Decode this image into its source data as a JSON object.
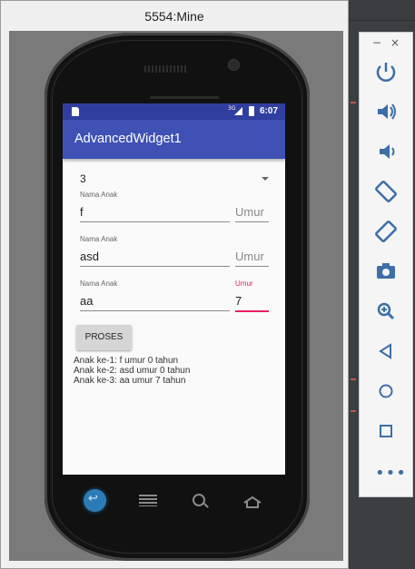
{
  "emulator": {
    "title": "5554:Mine"
  },
  "statusbar": {
    "network": "3G",
    "time": "6:07"
  },
  "app": {
    "title": "AdvancedWidget1"
  },
  "spinner": {
    "selected": "3"
  },
  "rows": [
    {
      "name_label": "Nama Anak",
      "name_value": "f",
      "age_placeholder": "Umur",
      "age_value": ""
    },
    {
      "name_label": "Nama Anak",
      "name_value": "asd",
      "age_placeholder": "Umur",
      "age_value": ""
    },
    {
      "name_label": "Nama Anak",
      "name_value": "aa",
      "age_label": "Umur",
      "age_value": "7"
    }
  ],
  "button": {
    "label": "PROSES"
  },
  "results": [
    "Anak ke-1: f umur 0 tahun",
    "Anak ke-2: asd umur 0 tahun",
    "Anak ke-3: aa umur 7 tahun"
  ],
  "side_panel": {
    "controls": [
      "−",
      "×"
    ],
    "tools": [
      "power-icon",
      "volume-up-icon",
      "volume-down-icon",
      "rotate-left-icon",
      "rotate-right-icon",
      "camera-icon",
      "zoom-icon",
      "back-icon",
      "home-icon",
      "overview-icon",
      "more-icon"
    ],
    "more_label": "•••"
  },
  "colors": {
    "primary": "#3f51b5",
    "primary_dark": "#303f9f",
    "accent": "#e91e63",
    "tool_blue": "#3d6ea8"
  }
}
